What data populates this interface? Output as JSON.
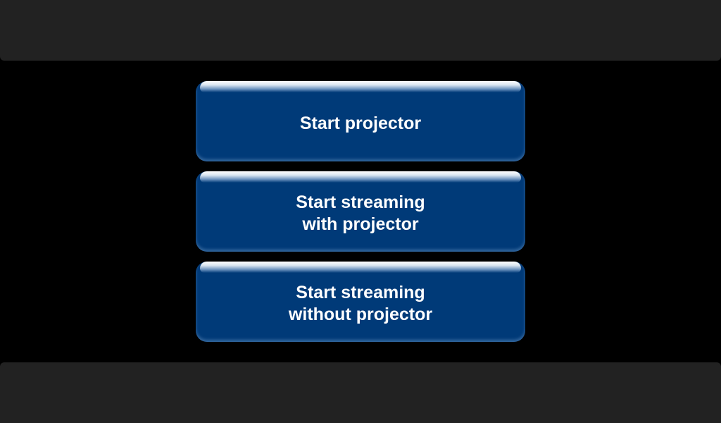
{
  "colors": {
    "background": "#000000",
    "bar": "#222222",
    "button": "#003a78",
    "button_text": "#ffffff"
  },
  "menu": {
    "buttons": [
      {
        "label": "Start projector"
      },
      {
        "label": "Start streaming\nwith projector"
      },
      {
        "label": "Start streaming\nwithout projector"
      }
    ]
  }
}
